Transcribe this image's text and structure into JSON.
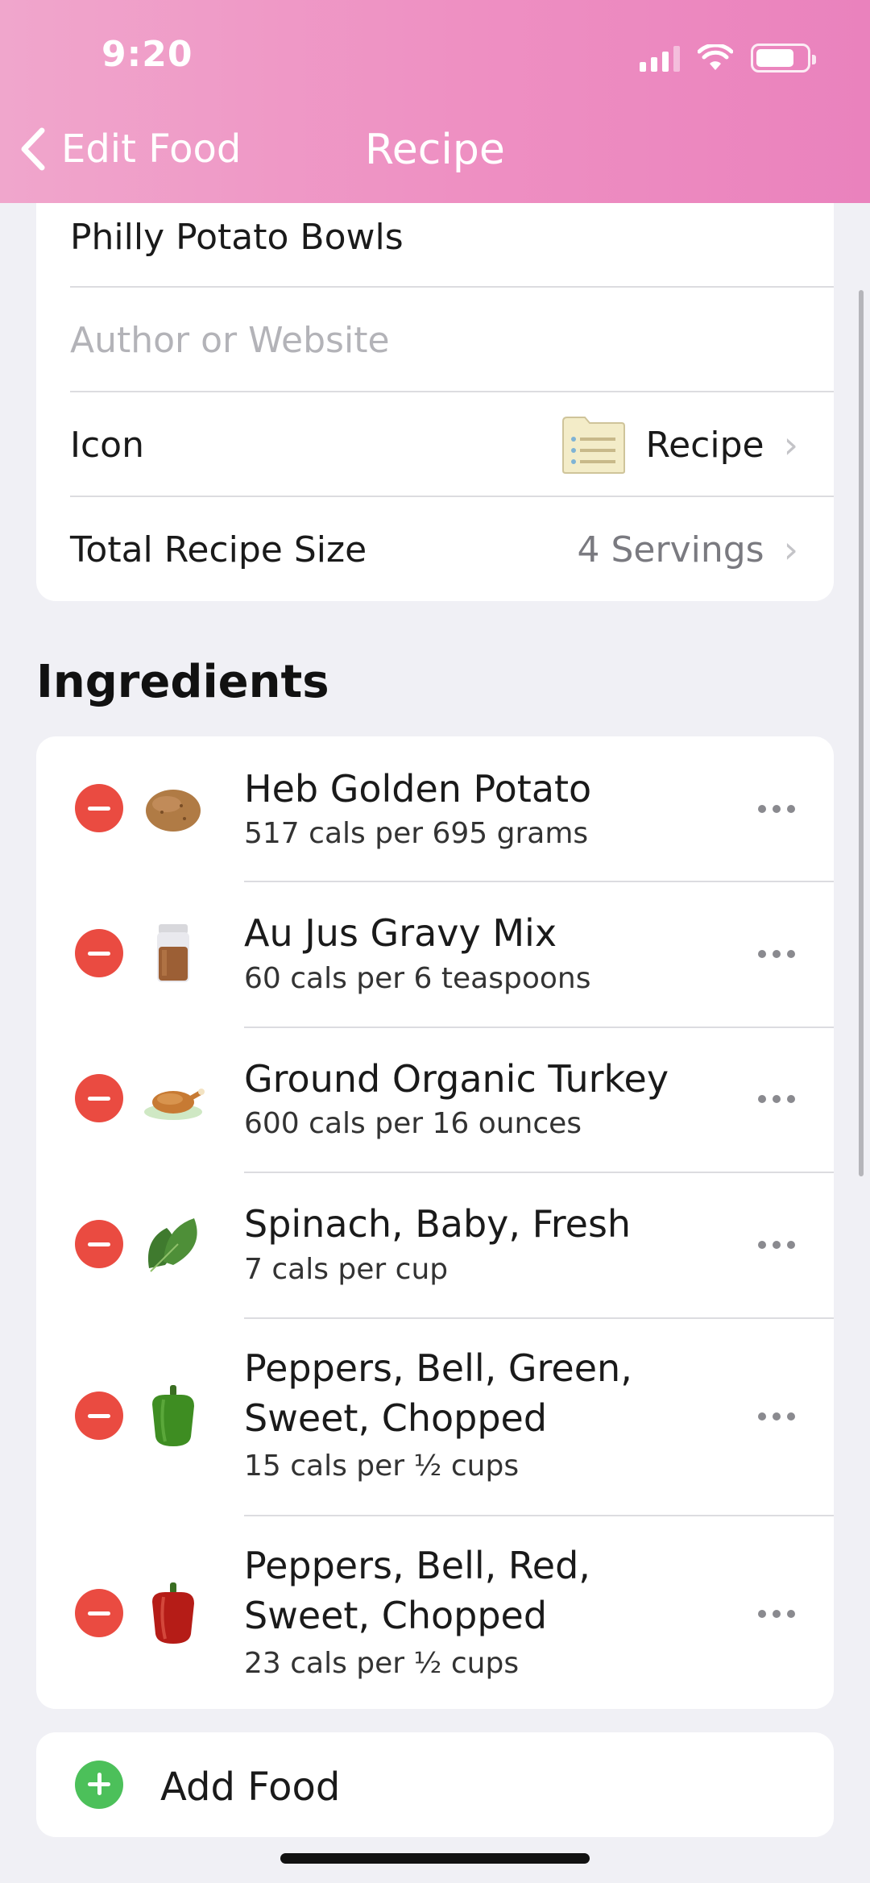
{
  "status_bar": {
    "time": "9:20",
    "icons": [
      "signal-icon",
      "wifi-icon",
      "battery-icon"
    ]
  },
  "nav": {
    "back_label": "Edit Food",
    "title": "Recipe"
  },
  "details": {
    "recipe_name": "Philly Potato Bowls",
    "author_placeholder": "Author or Website",
    "icon_label": "Icon",
    "icon_value": "Recipe",
    "size_label": "Total Recipe Size",
    "size_value": "4 Servings"
  },
  "ingredients": {
    "title": "Ingredients",
    "items": [
      {
        "name": "Heb Golden Potato",
        "calories": "517 cals per 695 grams",
        "icon": "potato-icon"
      },
      {
        "name": "Au Jus Gravy Mix",
        "calories": "60 cals per 6 teaspoons",
        "icon": "spice-jar-icon"
      },
      {
        "name": "Ground Organic Turkey",
        "calories": "600 cals per 16 ounces",
        "icon": "roast-turkey-icon"
      },
      {
        "name": "Spinach, Baby, Fresh",
        "calories": "7 cals per cup",
        "icon": "spinach-leaf-icon"
      },
      {
        "name_line1": "Peppers, Bell, Green,",
        "name_line2": "Sweet, Chopped",
        "calories": "15 cals per ½ cups",
        "icon": "green-pepper-icon"
      },
      {
        "name_line1": "Peppers, Bell, Red,",
        "name_line2": "Sweet, Chopped",
        "calories": "23 cals per ½ cups",
        "icon": "red-pepper-icon"
      }
    ]
  },
  "add_food": {
    "label": "Add Food"
  },
  "colors": {
    "header_pink": "#ee8fc2",
    "delete_red": "#ea4b41",
    "add_green": "#4cc05a"
  }
}
